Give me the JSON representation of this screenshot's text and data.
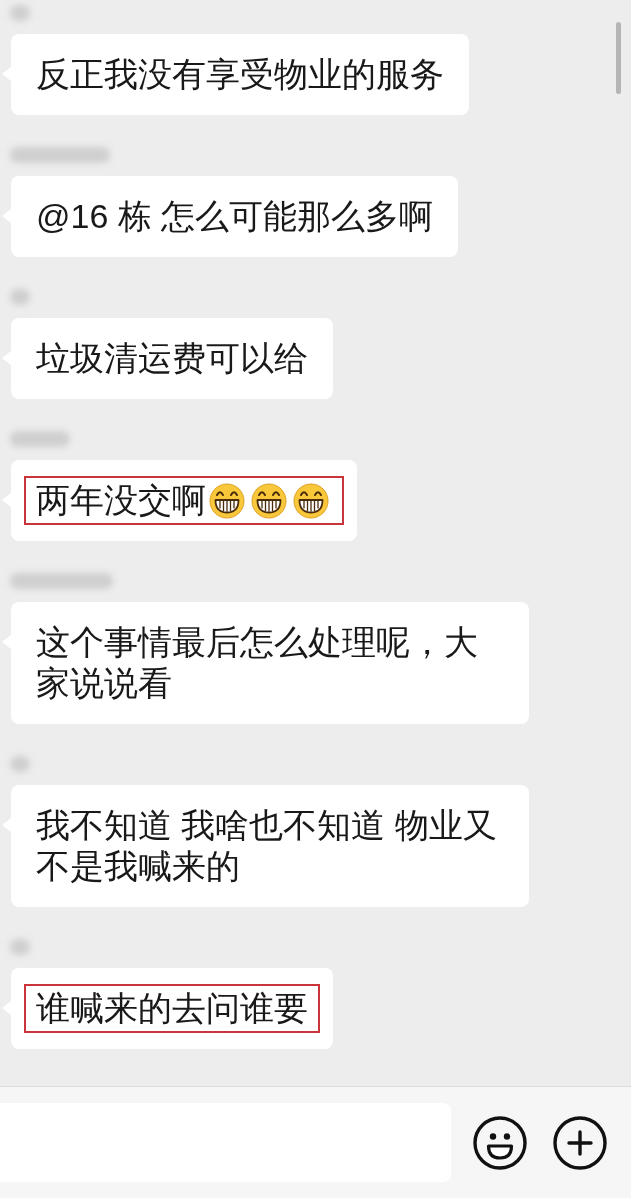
{
  "messages": [
    {
      "text": "反正我没有享受物业的服务",
      "highlighted": false
    },
    {
      "text": "@16 栋 怎么可能那么多啊",
      "highlighted": false
    },
    {
      "text": "垃圾清运费可以给",
      "highlighted": false
    },
    {
      "text": "两年没交啊",
      "emojis": [
        {
          "kind": "grin"
        },
        {
          "kind": "grin"
        },
        {
          "kind": "grin"
        }
      ],
      "highlighted": true
    },
    {
      "text": "这个事情最后怎么处理呢，大家说说看",
      "highlighted": false
    },
    {
      "text": "我不知道 我啥也不知道 物业又不是我喊来的",
      "highlighted": false
    },
    {
      "text": "谁喊来的去问谁要",
      "highlighted": true
    }
  ]
}
